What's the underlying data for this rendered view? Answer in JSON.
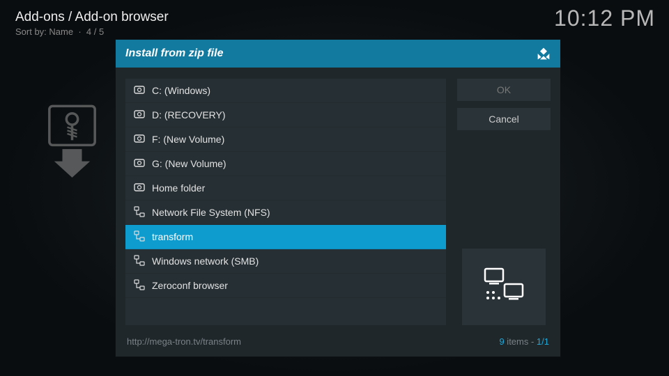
{
  "header": {
    "breadcrumb": "Add-ons / Add-on browser",
    "sort_label": "Sort by: Name",
    "page_indicator": "4 / 5"
  },
  "clock": "10:12 PM",
  "dialog": {
    "title": "Install from zip file",
    "items": [
      {
        "label": "C: (Windows)",
        "icon": "drive"
      },
      {
        "label": "D: (RECOVERY)",
        "icon": "drive"
      },
      {
        "label": "F: (New Volume)",
        "icon": "drive"
      },
      {
        "label": "G: (New Volume)",
        "icon": "drive"
      },
      {
        "label": "Home folder",
        "icon": "drive"
      },
      {
        "label": "Network File System (NFS)",
        "icon": "network"
      },
      {
        "label": "transform",
        "icon": "network",
        "selected": true
      },
      {
        "label": "Windows network (SMB)",
        "icon": "network"
      },
      {
        "label": "Zeroconf browser",
        "icon": "network"
      }
    ],
    "ok_label": "OK",
    "cancel_label": "Cancel",
    "footer_path": "http://mega-tron.tv/transform",
    "footer_count_num": "9",
    "footer_count_items": " items - ",
    "footer_count_page": "1/1"
  }
}
